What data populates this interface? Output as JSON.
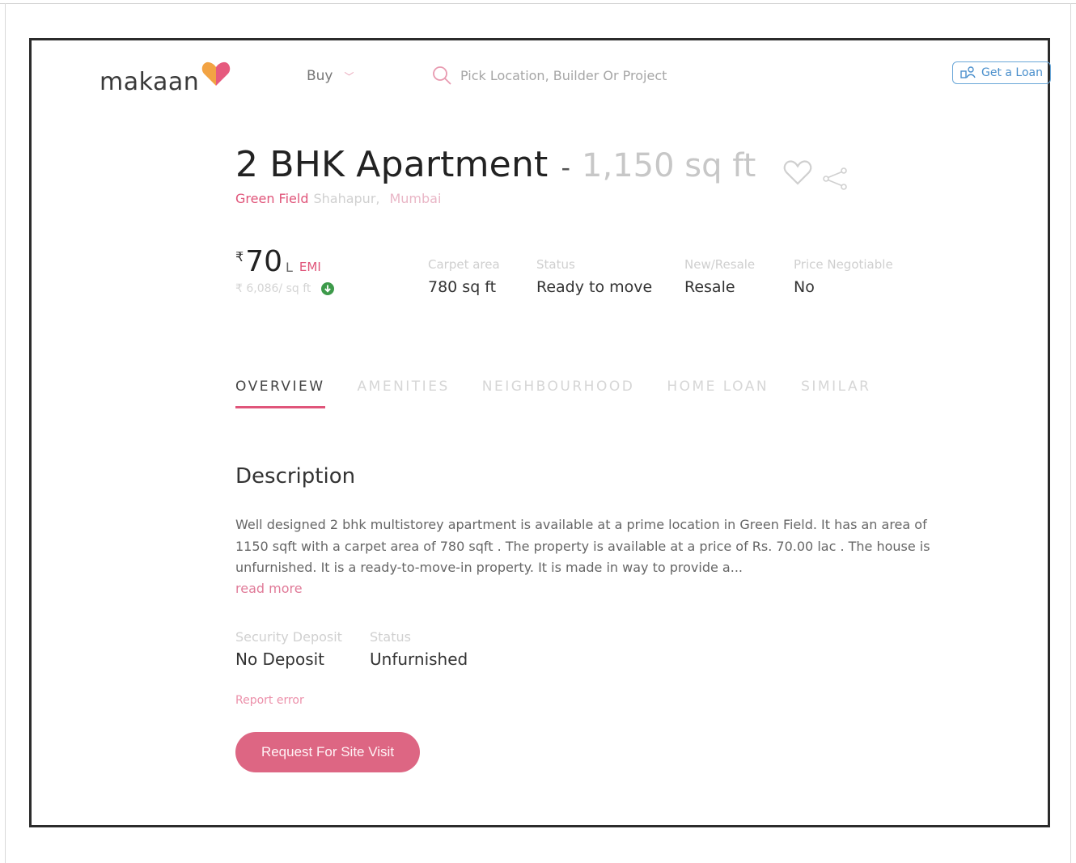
{
  "header": {
    "logo_text": "makaan",
    "nav_buy": "Buy",
    "search_placeholder": "Pick Location, Builder Or Project",
    "loan_button": "Get a Loan"
  },
  "property": {
    "title": "2 BHK Apartment",
    "separator": "-",
    "area": "1,150 sq ft",
    "location": {
      "locality": "Green Field",
      "sub_area": "Shahapur,",
      "city": "Mumbai"
    },
    "price": {
      "currency": "₹",
      "value": "70",
      "unit": "L",
      "emi_label": "EMI",
      "per_sqft": "₹ 6,086/ sq ft"
    },
    "specs": [
      {
        "label": "Carpet area",
        "value": "780 sq ft"
      },
      {
        "label": "Status",
        "value": "Ready to move"
      },
      {
        "label": "New/Resale",
        "value": "Resale"
      },
      {
        "label": "Price Negotiable",
        "value": "No"
      }
    ]
  },
  "tabs": [
    {
      "label": "OVERVIEW",
      "active": true
    },
    {
      "label": "AMENITIES",
      "active": false
    },
    {
      "label": "NEIGHBOURHOOD",
      "active": false
    },
    {
      "label": "HOME LOAN",
      "active": false
    },
    {
      "label": "SIMILAR",
      "active": false
    }
  ],
  "description": {
    "title": "Description",
    "text": "Well designed 2 bhk multistorey apartment is available at a prime location in Green Field. It has an area of 1150 sqft with a carpet area of 780 sqft . The property is available at a price of Rs. 70.00 lac . The house is unfurnished. It is a ready-to-move-in property. It is made in way to provide a...",
    "read_more": "read more"
  },
  "facts": [
    {
      "label": "Security Deposit",
      "value": "No Deposit"
    },
    {
      "label": "Status",
      "value": "Unfurnished"
    }
  ],
  "report_error": "Report error",
  "cta": {
    "site_visit": "Request For Site Visit"
  },
  "colors": {
    "brand_pink": "#e0557a",
    "button_pink": "#dd6683",
    "loan_blue": "#4a8fcc",
    "info_green": "#3d9a4a"
  }
}
